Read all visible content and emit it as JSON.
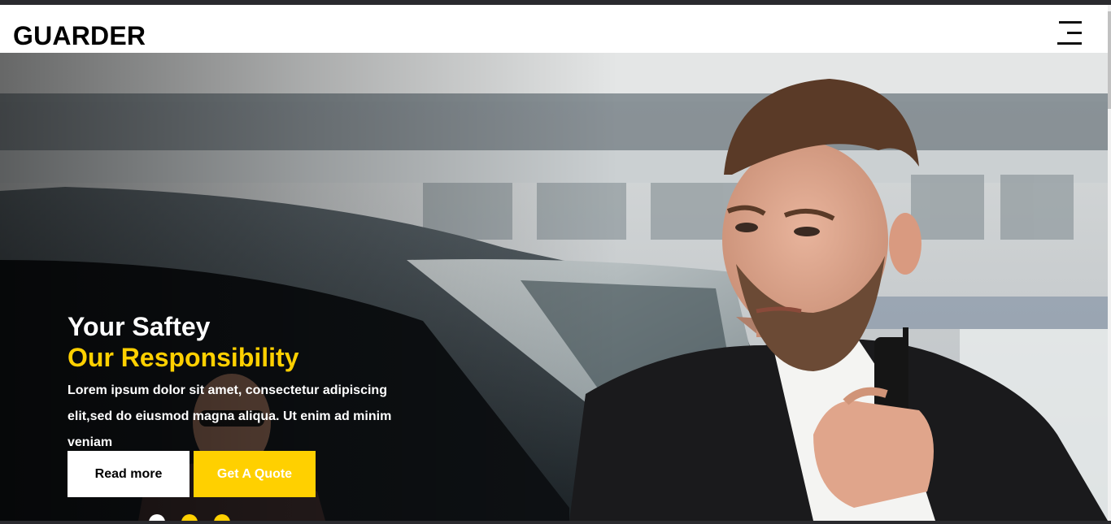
{
  "header": {
    "brand": "GUARDER",
    "menu_icon": "hamburger-menu-icon"
  },
  "hero": {
    "title": "Your Saftey",
    "subtitle": "Our Responsibility",
    "description": "Lorem ipsum dolor sit amet, consectetur adipiscing elit,sed do eiusmod magna aliqua. Ut enim ad minim veniam",
    "buttons": {
      "read_more": "Read more",
      "get_quote": "Get A Quote"
    },
    "slider": {
      "count": 3,
      "active": 1
    }
  },
  "colors": {
    "accent": "#ffd000",
    "text_light": "#ffffff",
    "brand_text": "#000000"
  }
}
